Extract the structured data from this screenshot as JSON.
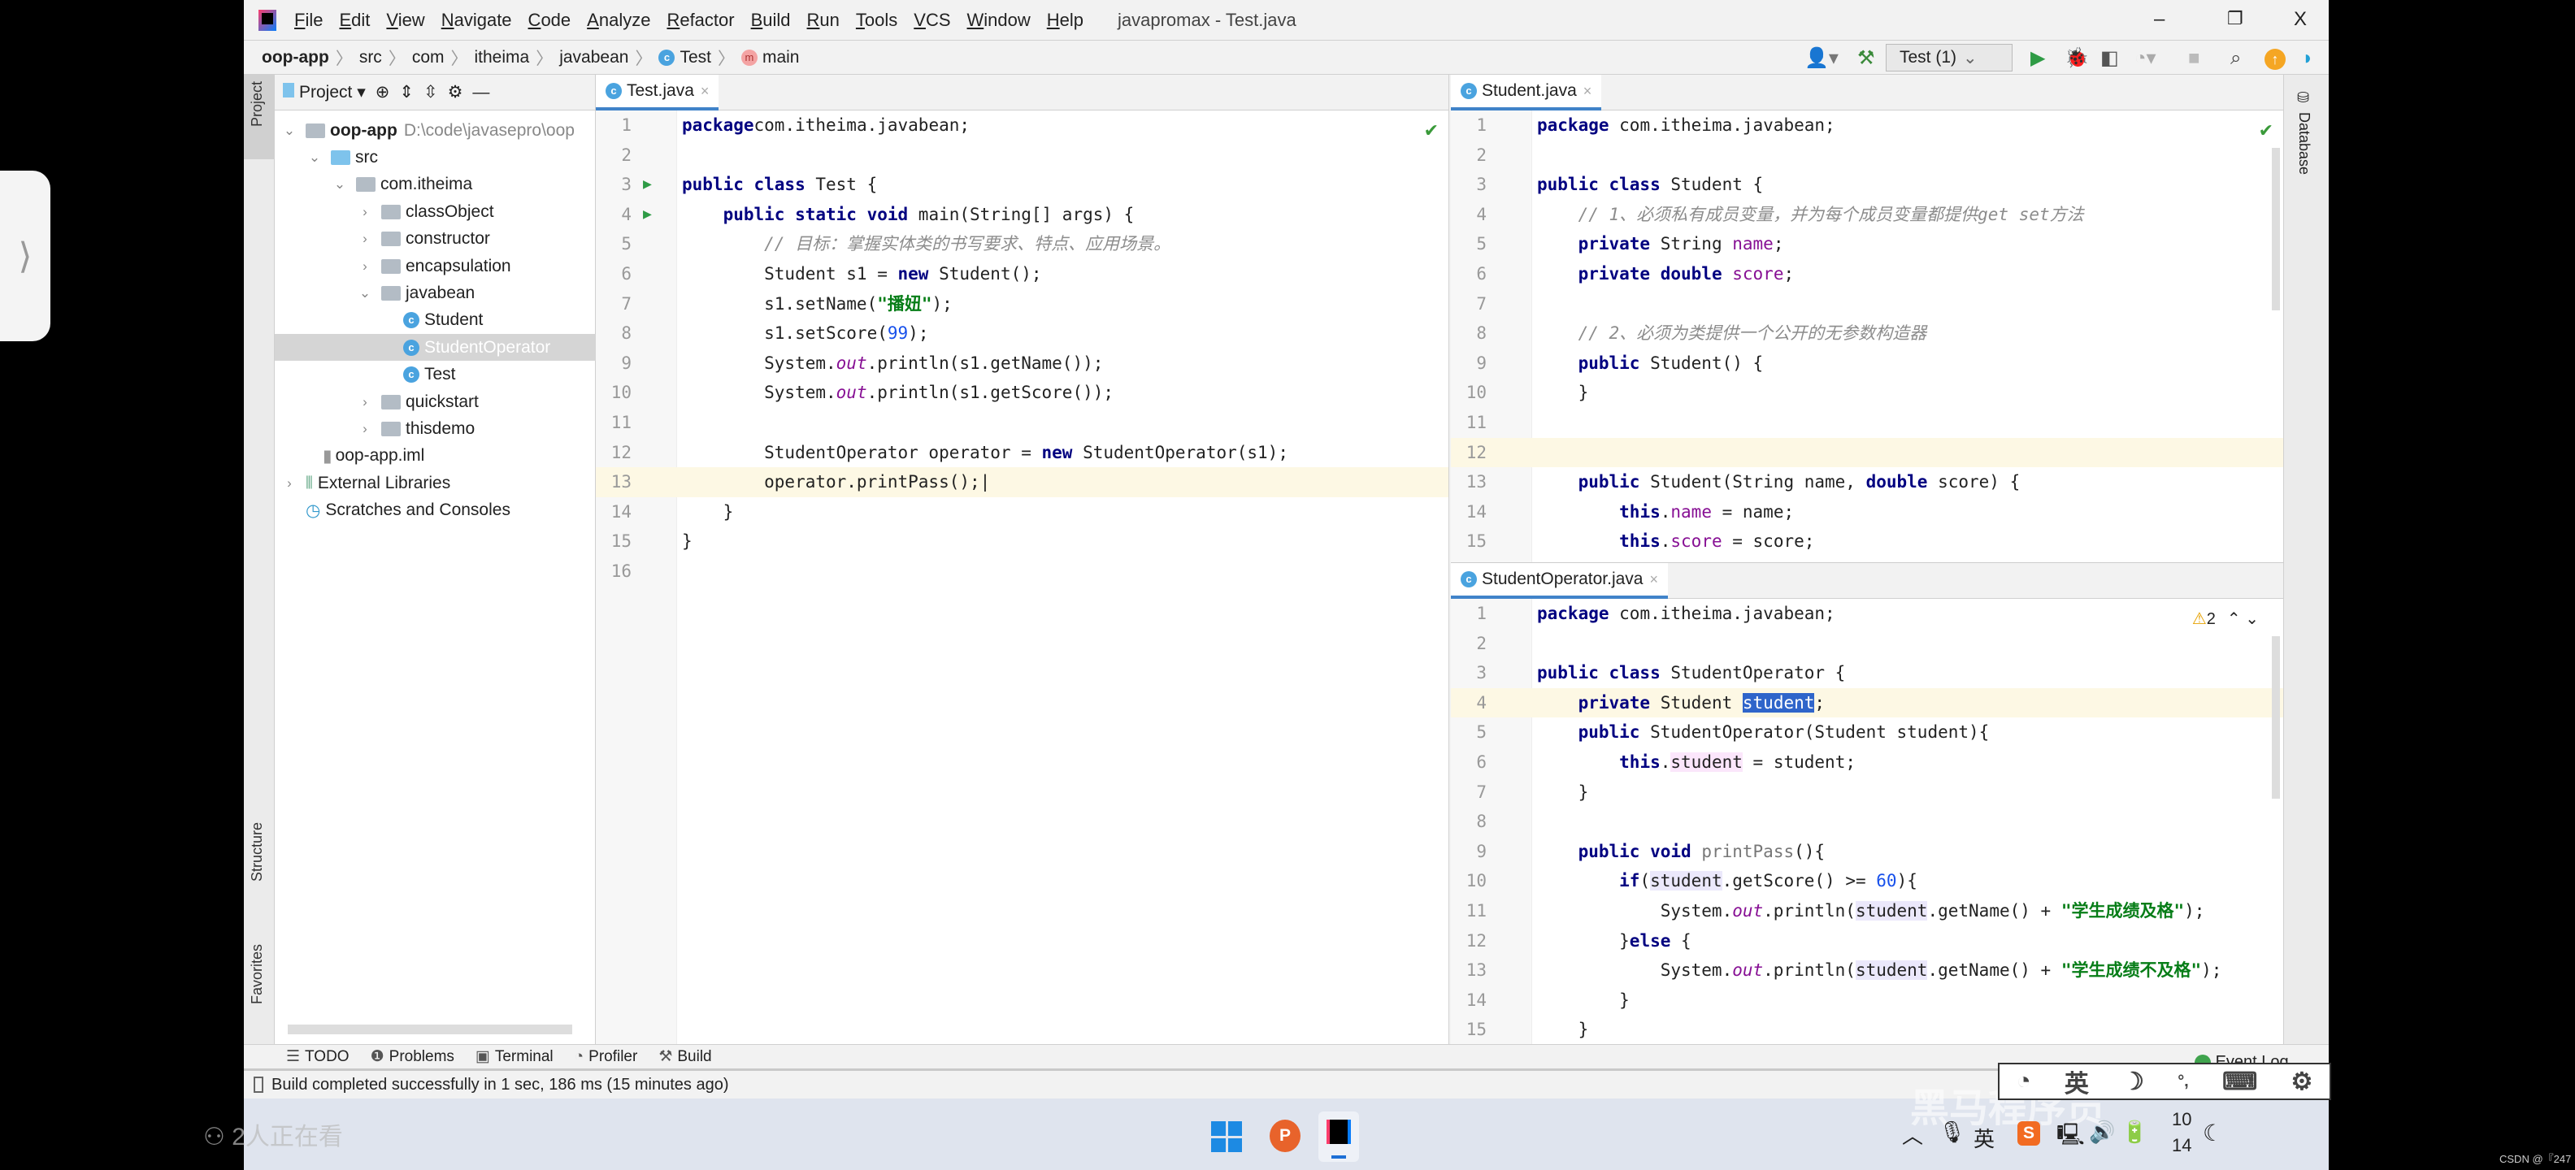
{
  "window": {
    "title": "javapromax - Test.java",
    "controls": [
      "–",
      "❐",
      "X"
    ]
  },
  "menu": [
    "File",
    "Edit",
    "View",
    "Navigate",
    "Code",
    "Analyze",
    "Refactor",
    "Build",
    "Run",
    "Tools",
    "VCS",
    "Window",
    "Help"
  ],
  "breadcrumb": [
    "oop-app",
    "src",
    "com",
    "itheima",
    "javabean",
    "Test",
    "main"
  ],
  "toolbar": {
    "run_config": "Test (1)"
  },
  "stripes": {
    "project": "Project",
    "structure": "Structure",
    "favorites": "Favorites",
    "database": "Database"
  },
  "project_panel": {
    "title": "Project",
    "tree": [
      {
        "label": "oop-app",
        "path": "D:\\code\\javasepro\\oop",
        "level": 0,
        "chevron": "v",
        "icon": "module"
      },
      {
        "label": "src",
        "level": 1,
        "chevron": "v",
        "icon": "src-folder"
      },
      {
        "label": "com.itheima",
        "level": 2,
        "chevron": "v",
        "icon": "package"
      },
      {
        "label": "classObject",
        "level": 3,
        "chevron": ">",
        "icon": "package"
      },
      {
        "label": "constructor",
        "level": 3,
        "chevron": ">",
        "icon": "package"
      },
      {
        "label": "encapsulation",
        "level": 3,
        "chevron": ">",
        "icon": "package"
      },
      {
        "label": "javabean",
        "level": 3,
        "chevron": "v",
        "icon": "package"
      },
      {
        "label": "Student",
        "level": 4,
        "chevron": "",
        "icon": "class"
      },
      {
        "label": "StudentOperator",
        "level": 4,
        "chevron": "",
        "icon": "class",
        "selected": true
      },
      {
        "label": "Test",
        "level": 4,
        "chevron": "",
        "icon": "class-run"
      },
      {
        "label": "quickstart",
        "level": 3,
        "chevron": ">",
        "icon": "package"
      },
      {
        "label": "thisdemo",
        "level": 3,
        "chevron": ">",
        "icon": "package"
      },
      {
        "label": "oop-app.iml",
        "level": 1,
        "chevron": "",
        "icon": "file"
      },
      {
        "label": "External Libraries",
        "level": 0,
        "chevron": ">",
        "icon": "libraries"
      },
      {
        "label": "Scratches and Consoles",
        "level": 0,
        "chevron": "",
        "icon": "scratches"
      }
    ]
  },
  "editors": [
    {
      "tab": "Test.java",
      "current_line": 13,
      "run_lines": [
        3,
        4
      ],
      "lines": [
        [
          [
            "kw",
            "package"
          ],
          [
            "",
            "com.itheima.javabean;"
          ]
        ],
        [],
        [
          [
            "kw",
            "public class"
          ],
          [
            "",
            " Test {"
          ]
        ],
        [
          [
            "",
            "    "
          ],
          [
            "kw",
            "public static void"
          ],
          [
            "",
            " main(String[] args) {"
          ]
        ],
        [
          [
            "",
            "        "
          ],
          [
            "cm",
            "// 目标：掌握实体类的书写要求、特点、应用场景。"
          ]
        ],
        [
          [
            "",
            "        Student s1 = "
          ],
          [
            "kw",
            "new"
          ],
          [
            "",
            " Student();"
          ]
        ],
        [
          [
            "",
            "        s1.setName("
          ],
          [
            "str",
            "\"播妞\""
          ],
          [
            "",
            ");"
          ]
        ],
        [
          [
            "",
            "        s1.setScore("
          ],
          [
            "num",
            "99"
          ],
          [
            "",
            ");"
          ]
        ],
        [
          [
            "",
            "        System."
          ],
          [
            "st",
            "out"
          ],
          [
            "",
            ".println(s1.getName());"
          ]
        ],
        [
          [
            "",
            "        System."
          ],
          [
            "st",
            "out"
          ],
          [
            "",
            ".println(s1.getScore());"
          ]
        ],
        [],
        [
          [
            "",
            "        StudentOperator operator = "
          ],
          [
            "kw",
            "new"
          ],
          [
            "",
            " StudentOperator(s1);"
          ]
        ],
        [
          [
            "",
            "        operator.printPass();|"
          ]
        ],
        [
          [
            "",
            "    }"
          ]
        ],
        [
          [
            "",
            "}"
          ]
        ],
        []
      ]
    },
    {
      "tab": "Student.java",
      "current_line": 12,
      "lines": [
        [
          [
            "kw",
            "package"
          ],
          [
            "",
            " com.itheima.javabean;"
          ]
        ],
        [],
        [
          [
            "kw",
            "public class"
          ],
          [
            "",
            " Student {"
          ]
        ],
        [
          [
            "",
            "    "
          ],
          [
            "cm",
            "// 1、必须私有成员变量，并为每个成员变量都提供get set方法"
          ]
        ],
        [
          [
            "",
            "    "
          ],
          [
            "kw",
            "private"
          ],
          [
            "",
            " String "
          ],
          [
            "fld",
            "name"
          ],
          [
            "",
            ";"
          ]
        ],
        [
          [
            "",
            "    "
          ],
          [
            "kw",
            "private double"
          ],
          [
            "",
            " "
          ],
          [
            "fld",
            "score"
          ],
          [
            "",
            ";"
          ]
        ],
        [],
        [
          [
            "",
            "    "
          ],
          [
            "cm",
            "// 2、必须为类提供一个公开的无参数构造器"
          ]
        ],
        [
          [
            "",
            "    "
          ],
          [
            "kw",
            "public"
          ],
          [
            "",
            " Student() {"
          ]
        ],
        [
          [
            "",
            "    }"
          ]
        ],
        [],
        [],
        [
          [
            "",
            "    "
          ],
          [
            "kw",
            "public"
          ],
          [
            "",
            " Student(String name, "
          ],
          [
            "kw",
            "double"
          ],
          [
            "",
            " score) {"
          ]
        ],
        [
          [
            "",
            "        "
          ],
          [
            "kw",
            "this"
          ],
          [
            "",
            "."
          ],
          [
            "fld",
            "name"
          ],
          [
            "",
            " = name;"
          ]
        ],
        [
          [
            "",
            "        "
          ],
          [
            "kw",
            "this"
          ],
          [
            "",
            "."
          ],
          [
            "fld",
            "score"
          ],
          [
            "",
            " = score;"
          ]
        ]
      ]
    },
    {
      "tab": "StudentOperator.java",
      "current_line": 4,
      "warnings": "2",
      "lines": [
        [
          [
            "kw",
            "package"
          ],
          [
            "",
            " com.itheima.javabean;"
          ]
        ],
        [],
        [
          [
            "kw",
            "public class"
          ],
          [
            "",
            " StudentOperator {"
          ]
        ],
        [
          [
            "",
            "    "
          ],
          [
            "kw",
            "private"
          ],
          [
            "",
            " Student "
          ],
          [
            "sel",
            "student"
          ],
          [
            "",
            ";"
          ]
        ],
        [
          [
            "",
            "    "
          ],
          [
            "kw",
            "public"
          ],
          [
            "",
            " StudentOperator(Student student){"
          ]
        ],
        [
          [
            "",
            "        "
          ],
          [
            "kw",
            "this"
          ],
          [
            "",
            "."
          ],
          [
            "wr",
            "student"
          ],
          [
            "",
            " = student;"
          ]
        ],
        [
          [
            "",
            "    }"
          ]
        ],
        [],
        [
          [
            "",
            "    "
          ],
          [
            "kw",
            "public void"
          ],
          [
            "",
            " "
          ],
          [
            "unused",
            "printPass"
          ],
          [
            "",
            "(){"
          ]
        ],
        [
          [
            "",
            "        "
          ],
          [
            "kw",
            "if"
          ],
          [
            "",
            "("
          ],
          [
            "ref",
            "student"
          ],
          [
            "",
            ".getScore() >= "
          ],
          [
            "num",
            "60"
          ],
          [
            "",
            "){"
          ]
        ],
        [
          [
            "",
            "            System."
          ],
          [
            "st",
            "out"
          ],
          [
            "",
            ".println("
          ],
          [
            "ref",
            "student"
          ],
          [
            "",
            ".getName() + "
          ],
          [
            "str",
            "\"学生成绩及格\""
          ],
          [
            "",
            ");"
          ]
        ],
        [
          [
            "",
            "        }"
          ],
          [
            "kw",
            "else"
          ],
          [
            "",
            " {"
          ]
        ],
        [
          [
            "",
            "            System."
          ],
          [
            "st",
            "out"
          ],
          [
            "",
            ".println("
          ],
          [
            "ref",
            "student"
          ],
          [
            "",
            ".getName() + "
          ],
          [
            "str",
            "\"学生成绩不及格\""
          ],
          [
            "",
            ");"
          ]
        ],
        [
          [
            "",
            "        }"
          ]
        ],
        [
          [
            "",
            "    }"
          ]
        ]
      ]
    }
  ],
  "bottom_tools": [
    "TODO",
    "Problems",
    "Terminal",
    "Profiler",
    "Build"
  ],
  "status": "Build completed successfully in 1 sec, 186 ms (15 minutes ago)",
  "event_log": "Event Log",
  "overlay": {
    "viewers": "2人正在看",
    "watermark": "黑马程序员",
    "csdn": "CSDN @『247"
  },
  "ime": {
    "lang": "英",
    "tray_lang": "英"
  },
  "clock": {
    "line1": "10",
    "line2": "14"
  },
  "side_handle": "⟩"
}
